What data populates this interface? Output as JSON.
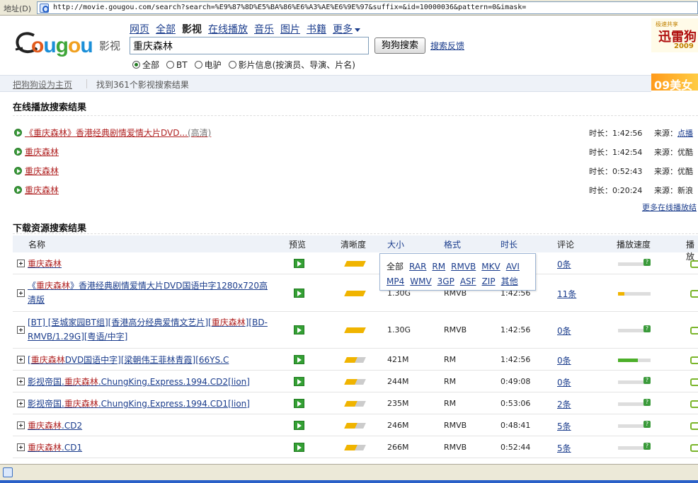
{
  "address": {
    "label": "地址(D)",
    "url": "http://movie.gougou.com/search?search=%E9%87%8D%E5%BA%86%E6%A3%AE%E6%9E%97&suffix=&id=10000036&pattern=0&imask="
  },
  "logo": {
    "brand": "Gougou",
    "sub": "影视"
  },
  "nav": {
    "items": [
      "网页",
      "全部",
      "影视",
      "在线播放",
      "音乐",
      "图片",
      "书籍",
      "更多"
    ],
    "current": "影视"
  },
  "search": {
    "value": "重庆森林",
    "button": "狗狗搜索",
    "feedback": "搜索反馈"
  },
  "filters": [
    {
      "label": "全部",
      "selected": true
    },
    {
      "label": "BT",
      "selected": false
    },
    {
      "label": "电驴",
      "selected": false
    },
    {
      "label": "影片信息(按演员、导演、片名)",
      "selected": false
    }
  ],
  "banner": {
    "small": "极速共享",
    "title": "迅雷狗",
    "year": "2009",
    "ad2": "09美女"
  },
  "infobar": {
    "homepage": "把狗狗设为主页",
    "count": "找到361个影视搜索结果"
  },
  "online": {
    "heading": "在线播放搜索结果",
    "rows": [
      {
        "title": "《重庆森林》香港经典剧情爱情大片DVD...",
        "quality": "(高清)",
        "duration": "时长：1:42:56",
        "source_label": "来源：",
        "source": "点播"
      },
      {
        "title": "重庆森林",
        "quality": "",
        "duration": "时长：1:42:54",
        "source_label": "来源：",
        "source": "优酷"
      },
      {
        "title": "重庆森林",
        "quality": "",
        "duration": "时长：0:52:43",
        "source_label": "来源：",
        "source": "优酷"
      },
      {
        "title": "重庆森林",
        "quality": "",
        "duration": "时长：0:20:24",
        "source_label": "来源：",
        "source": "新浪"
      }
    ],
    "more": "更多在线播放结"
  },
  "download": {
    "heading": "下载资源搜索结果",
    "columns": [
      "名称",
      "预览",
      "清晰度",
      "大小",
      "格式",
      "时长",
      "评论",
      "播放速度",
      "播放"
    ],
    "rows": [
      {
        "pre": "",
        "hl": "重庆森林",
        "post": "",
        "pre2": "",
        "size": "",
        "format": "",
        "duration": "",
        "comments": "0条",
        "clarity": 5,
        "speed": 0
      },
      {
        "pre": "《",
        "hl": "重庆森林",
        "post": "》香港经典剧情爱情大片DVD国语中字1280x720高清版",
        "size": "1.30G",
        "format": "RMVB",
        "duration": "1:42:56",
        "comments": "11条",
        "clarity": 5,
        "speed": 0.2
      },
      {
        "pre": "[BT] [圣城家园BT组][香港高分经典爱情文艺片][",
        "hl": "重庆森林",
        "post": "][BD-RMVB/1.29G][粤语/中字]",
        "size": "1.30G",
        "format": "RMVB",
        "duration": "1:42:56",
        "comments": "0条",
        "clarity": 5,
        "speed": 0
      },
      {
        "pre": "[",
        "hl": "重庆森林",
        "post": "DVD国语中字][梁朝伟王菲林青霞][66YS.C",
        "size": "421M",
        "format": "RM",
        "duration": "1:42:56",
        "comments": "0条",
        "clarity": 3,
        "speed": 0.6
      },
      {
        "pre": "影视帝国.",
        "hl": "重庆森林",
        "post": ".ChungKing.Express.1994.CD2[lion]",
        "size": "244M",
        "format": "RM",
        "duration": "0:49:08",
        "comments": "0条",
        "clarity": 3,
        "speed": 0
      },
      {
        "pre": "影视帝国.",
        "hl": "重庆森林",
        "post": ".ChungKing.Express.1994.CD1[lion]",
        "size": "235M",
        "format": "RM",
        "duration": "0:53:06",
        "comments": "2条",
        "clarity": 3,
        "speed": 0
      },
      {
        "pre": "",
        "hl": "重庆森林",
        "post": ".CD2",
        "size": "246M",
        "format": "RMVB",
        "duration": "0:48:41",
        "comments": "5条",
        "clarity": 3,
        "speed": 0
      },
      {
        "pre": "",
        "hl": "重庆森林",
        "post": ".CD1",
        "size": "266M",
        "format": "RMVB",
        "duration": "0:52:44",
        "comments": "5条",
        "clarity": 3,
        "speed": 0
      }
    ]
  },
  "format_popup": {
    "row1": [
      "全部",
      "RAR",
      "RM",
      "RMVB",
      "MKV",
      "AVI"
    ],
    "row2": [
      "MP4",
      "WMV",
      "3GP",
      "ASF",
      "ZIP",
      "其他"
    ]
  },
  "colors": {
    "link": "#1a3c8c",
    "highlight": "#b02222",
    "play_green": "#34a034",
    "clarity_on": "#f0b400",
    "header_bg": "#eef2f8"
  }
}
